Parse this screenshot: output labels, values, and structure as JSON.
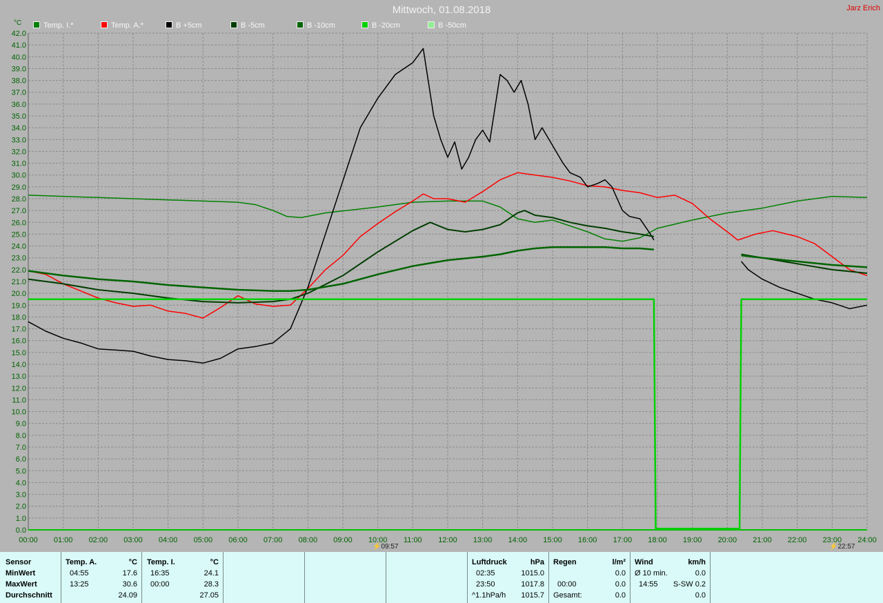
{
  "header": {
    "title": "Mittwoch, 01.08.2018",
    "author": "Jarz Erich",
    "y_unit": "°C"
  },
  "colors": {
    "background": "#b5b5b5",
    "grid": "#8c8c8c",
    "temp_i": "#008000",
    "temp_a": "#ff0000",
    "b_plus5": "#000000",
    "b_minus5": "#003c00",
    "b_minus10": "#006400",
    "b_minus20": "#00d000",
    "b_minus50": "#90ee90",
    "axis_text": "#006400",
    "panel": "#d9faf9"
  },
  "chart_data": {
    "type": "line",
    "title": "Mittwoch, 01.08.2018",
    "ylabel": "°C",
    "xlabel": "",
    "xlim": [
      0,
      24
    ],
    "ylim": [
      0,
      42
    ],
    "y_ticks": [
      "0.0",
      "1.0",
      "2.0",
      "3.0",
      "4.0",
      "5.0",
      "6.0",
      "7.0",
      "8.0",
      "9.0",
      "10.0",
      "11.0",
      "12.0",
      "13.0",
      "14.0",
      "15.0",
      "16.0",
      "17.0",
      "18.0",
      "19.0",
      "20.0",
      "21.0",
      "22.0",
      "23.0",
      "24.0",
      "25.0",
      "26.0",
      "27.0",
      "28.0",
      "29.0",
      "30.0",
      "31.0",
      "32.0",
      "33.0",
      "34.0",
      "35.0",
      "36.0",
      "37.0",
      "38.0",
      "39.0",
      "40.0",
      "41.0",
      "42.0"
    ],
    "x_ticks": [
      "00:00",
      "01:00",
      "02:00",
      "03:00",
      "04:00",
      "05:00",
      "06:00",
      "07:00",
      "08:00",
      "09:00",
      "10:00",
      "11:00",
      "12:00",
      "13:00",
      "14:00",
      "15:00",
      "16:00",
      "17:00",
      "18:00",
      "19:00",
      "20:00",
      "21:00",
      "22:00",
      "23:00",
      "24:00"
    ],
    "grid": true,
    "legend_position": "top-left",
    "series": [
      {
        "name": "Temp. I.*",
        "color": "#008000",
        "width": 1.5,
        "x": [
          0,
          1,
          2,
          3,
          4,
          5,
          6,
          6.5,
          7,
          7.4,
          7.8,
          8.5,
          10,
          11,
          12,
          13,
          13.5,
          14,
          14.5,
          15,
          16,
          16.5,
          17,
          17.5,
          18,
          19,
          20,
          21,
          22,
          23,
          24
        ],
        "y": [
          28.3,
          28.2,
          28.1,
          28.0,
          27.9,
          27.8,
          27.7,
          27.5,
          27.0,
          26.5,
          26.4,
          26.8,
          27.3,
          27.7,
          27.8,
          27.8,
          27.3,
          26.3,
          26.0,
          26.2,
          25.2,
          24.6,
          24.4,
          24.7,
          25.5,
          26.2,
          26.8,
          27.2,
          27.8,
          28.2,
          28.1
        ]
      },
      {
        "name": "Temp. A.*",
        "color": "#ff0000",
        "width": 1.5,
        "x": [
          0,
          0.5,
          1,
          1.5,
          2,
          2.5,
          3,
          3.5,
          4,
          4.5,
          5,
          5.5,
          6,
          6.5,
          7,
          7.5,
          8,
          8.5,
          9,
          9.5,
          10,
          10.5,
          11,
          11.3,
          11.6,
          12,
          12.5,
          13,
          13.5,
          14,
          14.5,
          15,
          15.5,
          16,
          16.5,
          17,
          17.5,
          18,
          18.5,
          19,
          19.5,
          20,
          20.3,
          20.8,
          21.3,
          22,
          22.5,
          23,
          23.5,
          24
        ],
        "y": [
          21.9,
          21.6,
          20.8,
          20.2,
          19.6,
          19.2,
          18.9,
          19.0,
          18.5,
          18.3,
          17.9,
          18.8,
          19.8,
          19.1,
          18.9,
          19.0,
          20.4,
          22.0,
          23.2,
          24.8,
          25.9,
          26.9,
          27.8,
          28.4,
          28.0,
          28.0,
          27.7,
          28.6,
          29.6,
          30.2,
          30.0,
          29.8,
          29.5,
          29.1,
          29.0,
          28.7,
          28.5,
          28.1,
          28.3,
          27.6,
          26.3,
          25.2,
          24.5,
          25.0,
          25.3,
          24.8,
          24.2,
          23.1,
          22.0,
          21.5
        ]
      },
      {
        "name": "B +5cm",
        "color": "#000000",
        "width": 1.5,
        "x": [
          0,
          0.5,
          1,
          1.5,
          2,
          2.5,
          3,
          3.5,
          4,
          4.5,
          5,
          5.5,
          6,
          6.5,
          7,
          7.5,
          8,
          8.5,
          9,
          9.5,
          10,
          10.5,
          11,
          11.3,
          11.6,
          11.8,
          12,
          12.2,
          12.4,
          12.6,
          12.8,
          13,
          13.2,
          13.5,
          13.7,
          13.9,
          14.1,
          14.3,
          14.5,
          14.7,
          15,
          15.3,
          15.5,
          15.8,
          16,
          16.3,
          16.5,
          16.7,
          17,
          17.2,
          17.5,
          17.8,
          17.9
        ],
        "y": [
          17.6,
          16.8,
          16.2,
          15.8,
          15.3,
          15.2,
          15.1,
          14.7,
          14.4,
          14.3,
          14.1,
          14.5,
          15.3,
          15.5,
          15.8,
          17.0,
          20.5,
          25.0,
          29.5,
          34.0,
          36.5,
          38.5,
          39.5,
          40.7,
          35.0,
          33.0,
          31.5,
          32.8,
          30.5,
          31.5,
          33.0,
          33.8,
          32.8,
          38.5,
          38.0,
          37.0,
          38.0,
          36.0,
          33.0,
          34.0,
          32.5,
          31.0,
          30.2,
          29.8,
          29.0,
          29.3,
          29.6,
          29.0,
          27.0,
          26.5,
          26.3,
          25.0,
          24.5
        ]
      },
      {
        "name": "B +5cm",
        "color": "#000000",
        "width": 1.5,
        "x": [
          20.4,
          20.6,
          21,
          21.5,
          22,
          22.5,
          23,
          23.5,
          24
        ],
        "y": [
          22.7,
          22.0,
          21.2,
          20.5,
          20.0,
          19.5,
          19.2,
          18.7,
          19.0
        ]
      },
      {
        "name": "B -5cm",
        "color": "#003c00",
        "width": 2.0,
        "x": [
          0,
          1,
          2,
          3,
          4,
          5,
          6,
          7,
          7.5,
          8,
          9,
          10,
          11,
          11.5,
          12,
          12.5,
          13,
          13.5,
          14,
          14.2,
          14.5,
          15,
          15.5,
          16,
          16.5,
          17,
          17.5,
          17.9
        ],
        "y": [
          21.2,
          20.8,
          20.3,
          20.0,
          19.6,
          19.3,
          19.2,
          19.3,
          19.5,
          20.0,
          21.5,
          23.5,
          25.3,
          26.0,
          25.4,
          25.2,
          25.4,
          25.8,
          26.8,
          27.0,
          26.6,
          26.4,
          26.0,
          25.7,
          25.5,
          25.2,
          25.0,
          24.8
        ]
      },
      {
        "name": "B -5cm",
        "color": "#003c00",
        "width": 2.0,
        "x": [
          20.4,
          21,
          22,
          23,
          24
        ],
        "y": [
          23.3,
          23.0,
          22.5,
          22.0,
          21.7
        ]
      },
      {
        "name": "B -10cm",
        "color": "#006400",
        "width": 2.5,
        "x": [
          0,
          1,
          2,
          3,
          4,
          5,
          6,
          7,
          7.5,
          8,
          9,
          10,
          11,
          12,
          13,
          13.5,
          14,
          14.5,
          15,
          15.5,
          16,
          16.5,
          17,
          17.5,
          17.9
        ],
        "y": [
          21.9,
          21.5,
          21.2,
          21.0,
          20.7,
          20.5,
          20.3,
          20.2,
          20.2,
          20.3,
          20.8,
          21.6,
          22.3,
          22.8,
          23.1,
          23.3,
          23.6,
          23.8,
          23.9,
          23.9,
          23.9,
          23.9,
          23.8,
          23.8,
          23.7
        ]
      },
      {
        "name": "B -10cm",
        "color": "#006400",
        "width": 2.5,
        "x": [
          20.4,
          21,
          22,
          23,
          24
        ],
        "y": [
          23.2,
          23.0,
          22.7,
          22.4,
          22.2
        ]
      },
      {
        "name": "B -20cm",
        "color": "#00d000",
        "width": 2.5,
        "x": [
          0,
          17.9,
          17.95,
          18.0,
          20.3,
          20.35,
          20.4,
          24
        ],
        "y": [
          19.5,
          19.5,
          0.1,
          0.1,
          0.1,
          0.1,
          19.5,
          19.5
        ]
      }
    ],
    "legend": [
      {
        "name": "Temp. I.*",
        "color": "#008000"
      },
      {
        "name": "Temp. A.*",
        "color": "#ff0000"
      },
      {
        "name": "B +5cm",
        "color": "#000000"
      },
      {
        "name": "B -5cm",
        "color": "#003c00"
      },
      {
        "name": "B -10cm",
        "color": "#006400"
      },
      {
        "name": "B -20cm",
        "color": "#00d000"
      },
      {
        "name": "B -50cm",
        "color": "#90ee90"
      }
    ],
    "events": [
      {
        "time": "09:57",
        "x": 10.0
      },
      {
        "time": "22:57",
        "x": 23.0
      }
    ]
  },
  "stats": {
    "sensor": {
      "header": "Sensor",
      "min": "MinWert",
      "max": "MaxWert",
      "avg": "Durchschnitt"
    },
    "temp_a": {
      "header": "Temp. A.",
      "unit": "°C",
      "min_time": "04:55",
      "min_val": "17.6",
      "max_time": "13:25",
      "max_val": "30.6",
      "avg": "24.09"
    },
    "temp_i": {
      "header": "Temp. I.",
      "unit": "°C",
      "min_time": "16:35",
      "min_val": "24.1",
      "max_time": "00:00",
      "max_val": "28.3",
      "avg": "27.05"
    },
    "pressure": {
      "header": "Luftdruck",
      "unit": "hPa",
      "min_time": "02:35",
      "min_val": "1015.0",
      "max_time": "23:50",
      "max_val": "1017.8",
      "trend": "^1.1hPa/h",
      "trend_val": "1015.7"
    },
    "rain": {
      "header": "Regen",
      "unit": "l/m²",
      "r1_val": "0.0",
      "r2_time": "00:00",
      "r2_val": "0.0",
      "r3_label": "Gesamt:",
      "r3_val": "0.0"
    },
    "wind": {
      "header": "Wind",
      "unit": "km/h",
      "r1_label": "Ø 10 min.",
      "r1_val": "0.0",
      "r2_time": "14:55",
      "r2_val": "S-SW 0.2",
      "r3_val": "0.0"
    }
  }
}
